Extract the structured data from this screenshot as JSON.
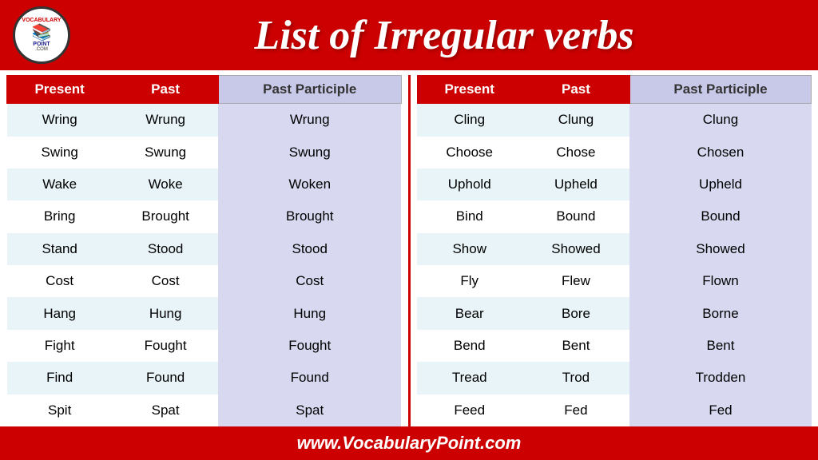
{
  "header": {
    "title": "List of Irregular verbs",
    "logo_lines": [
      "VOCABULARY",
      "POINT",
      ".COM"
    ]
  },
  "table1": {
    "headers": [
      "Present",
      "Past",
      "Past Participle"
    ],
    "rows": [
      [
        "Wring",
        "Wrung",
        "Wrung"
      ],
      [
        "Swing",
        "Swung",
        "Swung"
      ],
      [
        "Wake",
        "Woke",
        "Woken"
      ],
      [
        "Bring",
        "Brought",
        "Brought"
      ],
      [
        "Stand",
        "Stood",
        "Stood"
      ],
      [
        "Cost",
        "Cost",
        "Cost"
      ],
      [
        "Hang",
        "Hung",
        "Hung"
      ],
      [
        "Fight",
        "Fought",
        "Fought"
      ],
      [
        "Find",
        "Found",
        "Found"
      ],
      [
        "Spit",
        "Spat",
        "Spat"
      ]
    ]
  },
  "table2": {
    "headers": [
      "Present",
      "Past",
      "Past Participle"
    ],
    "rows": [
      [
        "Cling",
        "Clung",
        "Clung"
      ],
      [
        "Choose",
        "Chose",
        "Chosen"
      ],
      [
        "Uphold",
        "Upheld",
        "Upheld"
      ],
      [
        "Bind",
        "Bound",
        "Bound"
      ],
      [
        "Show",
        "Showed",
        "Showed"
      ],
      [
        "Fly",
        "Flew",
        "Flown"
      ],
      [
        "Bear",
        "Bore",
        "Borne"
      ],
      [
        "Bend",
        "Bent",
        "Bent"
      ],
      [
        "Tread",
        "Trod",
        "Trodden"
      ],
      [
        "Feed",
        "Fed",
        "Fed"
      ]
    ]
  },
  "footer": {
    "text": "www.VocabularyPoint.com"
  }
}
